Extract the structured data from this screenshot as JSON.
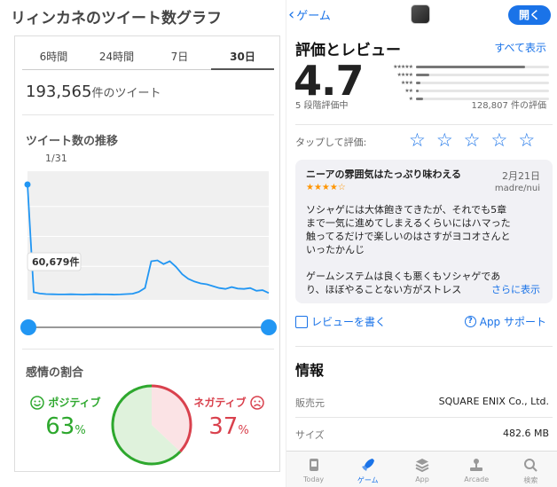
{
  "left": {
    "title": "リィンカネのツイート数グラフ",
    "tabs": [
      {
        "label": "6時間",
        "active": false
      },
      {
        "label": "24時間",
        "active": false
      },
      {
        "label": "7日",
        "active": false
      },
      {
        "label": "30日",
        "active": true
      }
    ],
    "total_value": "193,565",
    "total_unit": "件のツイート",
    "trend_title": "ツイート数の推移",
    "trend_date": "1/31",
    "tooltip_value": "60,679件",
    "sentiment_title": "感情の割合",
    "positive_label": "ポジティブ",
    "positive_pct": "63",
    "negative_label": "ネガティブ",
    "negative_pct": "37",
    "pct_unit": "%",
    "colors": {
      "accent": "#2196f3",
      "positive": "#2ea82e",
      "negative": "#d9414d",
      "chart_fill": "#f0f0f0"
    }
  },
  "chart_data": {
    "type": "area",
    "title": "ツイート数の推移",
    "x": [
      1,
      2,
      3,
      4,
      5,
      6,
      7,
      8,
      9,
      10,
      11,
      12,
      13,
      14,
      15,
      16,
      17,
      18,
      19,
      20,
      21,
      22,
      23,
      24,
      25,
      26,
      27,
      28,
      29,
      30,
      31,
      32,
      33,
      34,
      35,
      36,
      37,
      38,
      39,
      40
    ],
    "values": [
      60679,
      2200,
      1500,
      1200,
      1100,
      1000,
      1000,
      1100,
      1000,
      900,
      1000,
      1100,
      1000,
      1000,
      900,
      1000,
      1200,
      1400,
      2400,
      4500,
      19000,
      19500,
      17500,
      19000,
      16000,
      12000,
      9500,
      8000,
      7000,
      6500,
      5500,
      4500,
      4000,
      5000,
      4200,
      4000,
      4500,
      3000,
      3300,
      1800
    ],
    "ylim": [
      0,
      65000
    ],
    "annotation": {
      "index": 0,
      "label": "60,679件"
    }
  },
  "sentiment": {
    "positive": 63,
    "negative": 37
  },
  "right": {
    "back_label": "ゲーム",
    "open_label": "開く",
    "ratings_title": "評価とレビュー",
    "see_all": "すべて表示",
    "rating": "4.7",
    "rating_caption": "5 段階評価中",
    "rating_count": "128,807 件の評価",
    "distribution": [
      {
        "stars": "★★★★★",
        "fraction": 0.82
      },
      {
        "stars": "★★★★",
        "fraction": 0.1
      },
      {
        "stars": "★★★",
        "fraction": 0.03
      },
      {
        "stars": "★★",
        "fraction": 0.02
      },
      {
        "stars": "★",
        "fraction": 0.05
      }
    ],
    "tap_to_rate": "タップして評価:",
    "review": {
      "title": "ニーアの雰囲気はたっぷり味わえる",
      "date": "2月21日",
      "stars": "★★★★☆",
      "author": "madre/nui",
      "body": "ソシャゲには大体飽きてきたが、それでも5章\nまで一気に進めてしまえるくらいにはハマった\n触ってるだけで楽しいのはさすがヨコオさんと\nいったかんじ\n\nゲームシステムは良くも悪くもソシャゲであ\nり、ほぼやることない方がストレス",
      "more": "さらに表示"
    },
    "write_review": "レビューを書く",
    "app_support": "App サポート",
    "info_title": "情報",
    "info": [
      {
        "key": "販売元",
        "value": "SQUARE ENIX Co., Ltd."
      },
      {
        "key": "サイズ",
        "value": "482.6 MB"
      }
    ],
    "tabbar": [
      {
        "label": "Today",
        "icon": "today-icon",
        "active": false
      },
      {
        "label": "ゲーム",
        "icon": "rocket-icon",
        "active": true
      },
      {
        "label": "App",
        "icon": "stack-icon",
        "active": false
      },
      {
        "label": "Arcade",
        "icon": "joystick-icon",
        "active": false
      },
      {
        "label": "検索",
        "icon": "search-icon",
        "active": false
      }
    ]
  }
}
